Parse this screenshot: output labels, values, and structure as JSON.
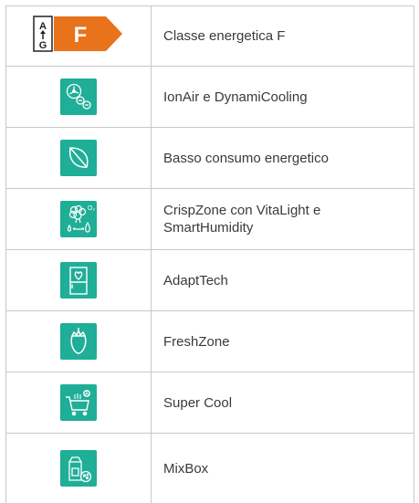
{
  "features": [
    {
      "icon": "energy-class-label-icon",
      "label": "Classe energetica F",
      "energy_class": {
        "top": "A",
        "bottom": "G",
        "letter": "F",
        "arrow_color": "#e8731a"
      }
    },
    {
      "icon": "ionair-fan-icon",
      "label": "IonAir e DynamiCooling"
    },
    {
      "icon": "leaf-icon",
      "label": "Basso consumo energetico"
    },
    {
      "icon": "crisp-vegetable-humidity-icon",
      "label": "CrispZone con VitaLight e SmartHumidity"
    },
    {
      "icon": "adapttech-fridge-heart-icon",
      "label": "AdaptTech"
    },
    {
      "icon": "strawberry-icon",
      "label": "FreshZone"
    },
    {
      "icon": "shopping-cart-cool-icon",
      "label": "Super Cool"
    },
    {
      "icon": "milk-cheese-box-icon",
      "label": "MixBox"
    }
  ],
  "colors": {
    "tile": "#1fae97",
    "border": "#c8c8c8",
    "text": "#3a3a3a"
  }
}
